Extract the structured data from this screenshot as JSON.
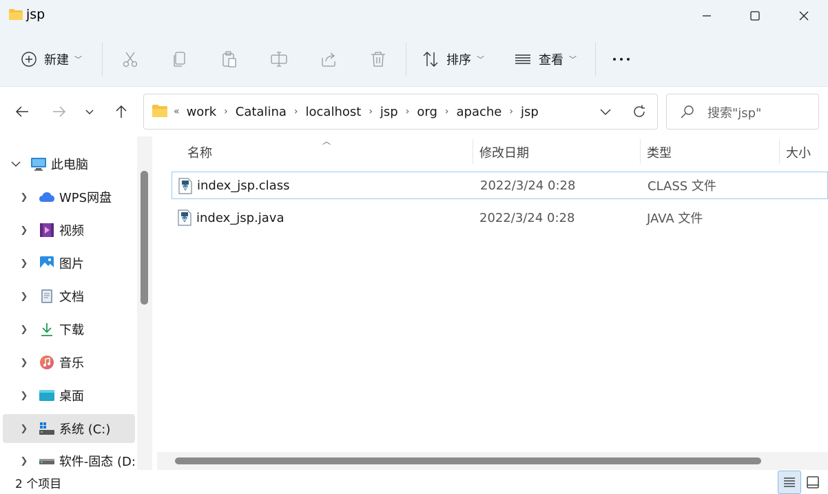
{
  "window": {
    "title": "jsp"
  },
  "titlebar": {
    "minimize_icon": "minimize-icon",
    "maximize_icon": "maximize-icon",
    "close_icon": "close-icon"
  },
  "commandbar": {
    "new_label": "新建",
    "sort_label": "排序",
    "view_label": "查看",
    "icons": [
      "plus-circle-icon",
      "cut-icon",
      "copy-icon",
      "paste-icon",
      "rename-icon",
      "share-icon",
      "delete-icon",
      "sort-icon",
      "view-icon",
      "more-icon"
    ]
  },
  "address": {
    "overflow": "«",
    "breadcrumbs": [
      "work",
      "Catalina",
      "localhost",
      "jsp",
      "org",
      "apache",
      "jsp"
    ],
    "search_placeholder": "搜索\"jsp\""
  },
  "sidebar": {
    "items": [
      {
        "label": "此电脑",
        "icon": "computer-icon",
        "expanded": true
      },
      {
        "label": "WPS网盘",
        "icon": "cloud-icon"
      },
      {
        "label": "视频",
        "icon": "video-icon"
      },
      {
        "label": "图片",
        "icon": "picture-icon"
      },
      {
        "label": "文档",
        "icon": "document-icon"
      },
      {
        "label": "下载",
        "icon": "download-icon"
      },
      {
        "label": "音乐",
        "icon": "music-icon"
      },
      {
        "label": "桌面",
        "icon": "desktop-icon"
      },
      {
        "label": "系统 (C:)",
        "icon": "drive-c-icon",
        "selected": true
      },
      {
        "label": "软件-固态 (D:",
        "icon": "drive-d-icon"
      }
    ]
  },
  "filelist": {
    "columns": [
      "名称",
      "修改日期",
      "类型",
      "大小"
    ],
    "rows": [
      {
        "name": "index_jsp.class",
        "date": "2022/3/24 0:28",
        "type": "CLASS 文件"
      },
      {
        "name": "index_jsp.java",
        "date": "2022/3/24 0:28",
        "type": "JAVA 文件"
      }
    ]
  },
  "statusbar": {
    "item_count": "2 个项目"
  },
  "colors": {
    "chrome": "#eff4f9",
    "selection_border": "#99c9ef",
    "folder": "#f8c244"
  }
}
